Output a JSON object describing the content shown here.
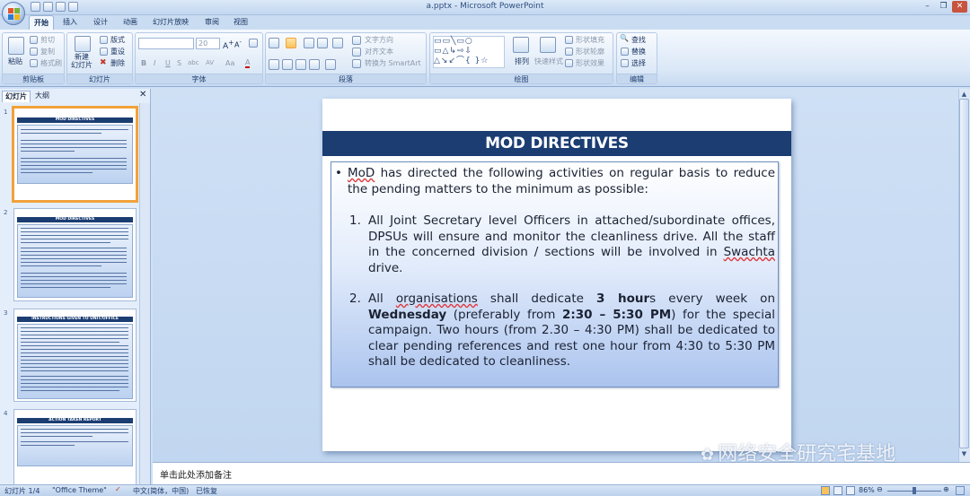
{
  "window": {
    "title": "a.pptx - Microsoft PowerPoint"
  },
  "ribbon": {
    "tabs": [
      "开始",
      "插入",
      "设计",
      "动画",
      "幻灯片放映",
      "审阅",
      "视图"
    ],
    "active_tab": "开始",
    "clipboard": {
      "paste": "粘贴",
      "cut": "剪切",
      "copy": "复制",
      "format_painter": "格式刷",
      "label": "剪贴板"
    },
    "slides": {
      "new_slide": "新建\n幻灯片",
      "layout": "版式",
      "reset": "重设",
      "delete": "删除",
      "label": "幻灯片"
    },
    "font": {
      "size": "20",
      "label": "字体",
      "buttons": [
        "B",
        "I",
        "U",
        "S",
        "abc",
        "AV",
        "Aa",
        "A"
      ]
    },
    "paragraph": {
      "text_direction": "文字方向",
      "align_text": "对齐文本",
      "convert_smartart": "转换为 SmartArt",
      "label": "段落"
    },
    "drawing": {
      "arrange": "排列",
      "quick_styles": "快速样式",
      "shape_fill": "形状填充",
      "shape_outline": "形状轮廓",
      "shape_effects": "形状效果",
      "label": "绘图"
    },
    "editing": {
      "find": "查找",
      "replace": "替换",
      "select": "选择",
      "label": "编辑"
    }
  },
  "left_pane": {
    "tabs": [
      "幻灯片",
      "大纲"
    ],
    "thumbnails": [
      {
        "num": "1",
        "title": "MOD DIRECTIVES"
      },
      {
        "num": "2",
        "title": "MOD DIRECTIVES"
      },
      {
        "num": "3",
        "title": "INSTRUCTIONS GIVEN TO UNIT/OFFICE"
      },
      {
        "num": "4",
        "title": "ACTION TAKEN REPORT"
      }
    ]
  },
  "slide": {
    "title": "MOD DIRECTIVES",
    "bullet_intro_a": "MoD",
    "bullet_intro_b": " has directed the following activities on regular basis to reduce the pending matters to the minimum as possible:",
    "item1_num": "1.",
    "item1_a": "All Joint Secretary level  Officers in attached/subordinate offices, DPSUs will ensure and monitor the cleanliness drive. All the staff in the concerned division / sections will be involved in ",
    "item1_b": "Swachta",
    "item1_c": " drive.",
    "item2_num": "2.",
    "item2_a": "All ",
    "item2_b": "organisations",
    "item2_c": " shall dedicate ",
    "item2_d": "3 hour",
    "item2_e": "s every week on ",
    "item2_f": "Wednesday",
    "item2_g": " (preferably  from ",
    "item2_h": "2:30 – 5:30 PM",
    "item2_i": ") for the special campaign. Two hours (from 2.30 – 4:30 PM) shall be dedicated to clear pending references and rest one hour from 4:30 to 5:30 PM shall be dedicated to cleanliness."
  },
  "notes": {
    "placeholder": "单击此处添加备注"
  },
  "status": {
    "slide_of": "幻灯片 1/4",
    "theme": "\"Office Theme\"",
    "language": "中文(简体，中国)",
    "recovered": "已恢复",
    "zoom": "86%"
  },
  "watermark": "网络安全研究宅基地",
  "colors": {
    "title_band": "#1b3d72",
    "accent": "#f1a23a"
  }
}
